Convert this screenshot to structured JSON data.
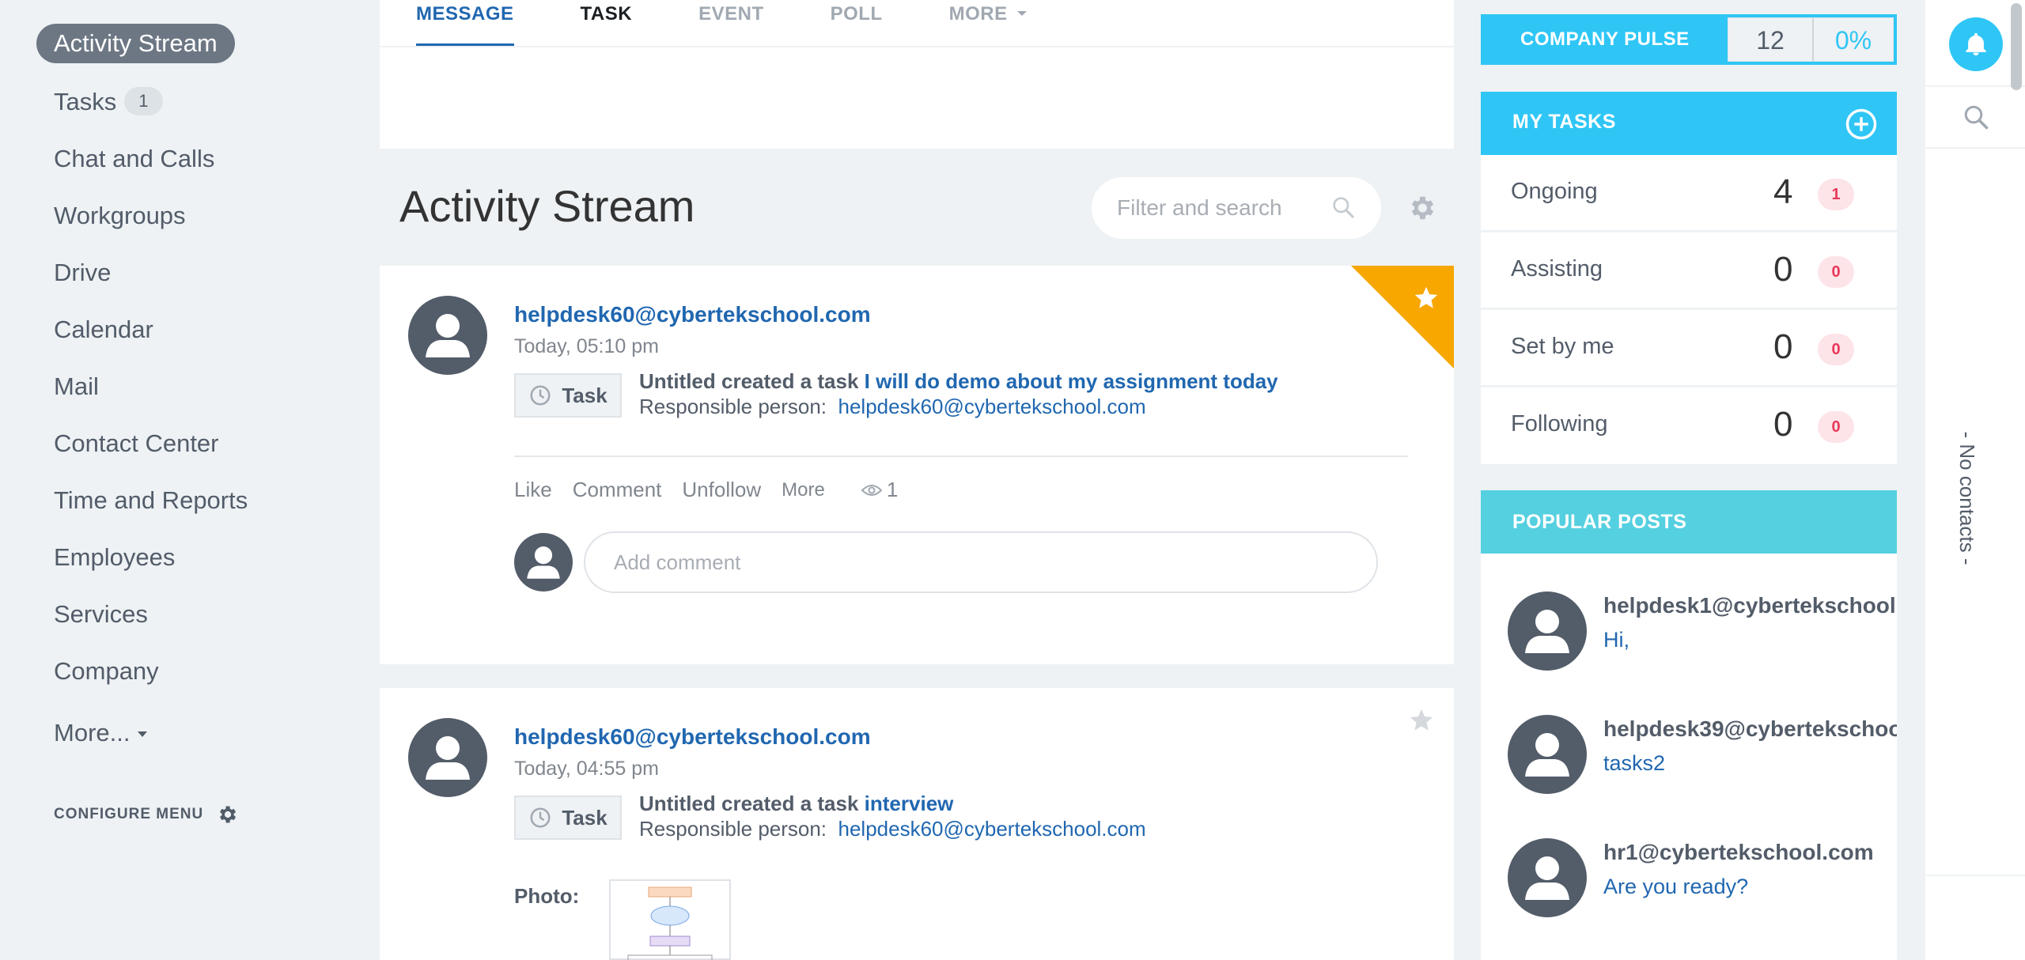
{
  "sidebar": {
    "items": [
      {
        "label": "Activity Stream"
      },
      {
        "label": "Tasks",
        "counter": "1"
      },
      {
        "label": "Chat and Calls"
      },
      {
        "label": "Workgroups"
      },
      {
        "label": "Drive"
      },
      {
        "label": "Calendar"
      },
      {
        "label": "Mail"
      },
      {
        "label": "Contact Center"
      },
      {
        "label": "Time and Reports"
      },
      {
        "label": "Employees"
      },
      {
        "label": "Services"
      },
      {
        "label": "Company"
      },
      {
        "label": "More..."
      }
    ],
    "configure_label": "CONFIGURE MENU"
  },
  "composer": {
    "tabs": [
      {
        "label": "MESSAGE"
      },
      {
        "label": "TASK"
      },
      {
        "label": "EVENT"
      },
      {
        "label": "POLL"
      },
      {
        "label": "MORE"
      }
    ]
  },
  "stream": {
    "title": "Activity Stream",
    "search_placeholder": "Filter and search"
  },
  "posts": [
    {
      "author": "helpdesk60@cybertekschool.com",
      "time": "Today, 05:10 pm",
      "chip": "Task",
      "creator_text": "Untitled created a task",
      "task_title": "I will do demo about my assignment today",
      "responsible_label": "Responsible person:",
      "responsible": "helpdesk60@cybertekschool.com",
      "actions": {
        "like": "Like",
        "comment": "Comment",
        "unfollow": "Unfollow",
        "more": "More",
        "views": "1"
      },
      "comment_placeholder": "Add comment",
      "starred": true
    },
    {
      "author": "helpdesk60@cybertekschool.com",
      "time": "Today, 04:55 pm",
      "chip": "Task",
      "creator_text": "Untitled created a task",
      "task_title": "interview",
      "responsible_label": "Responsible person:",
      "responsible": "helpdesk60@cybertekschool.com",
      "photo_label": "Photo:",
      "starred": false
    }
  ],
  "pulse": {
    "label": "COMPANY PULSE",
    "count": "12",
    "percent": "0%"
  },
  "my_tasks": {
    "title": "MY TASKS",
    "rows": [
      {
        "label": "Ongoing",
        "count": "4",
        "badge": "1"
      },
      {
        "label": "Assisting",
        "count": "0",
        "badge": "0"
      },
      {
        "label": "Set by me",
        "count": "0",
        "badge": "0"
      },
      {
        "label": "Following",
        "count": "0",
        "badge": "0"
      }
    ]
  },
  "popular": {
    "title": "POPULAR POSTS",
    "items": [
      {
        "name": "helpdesk1@cybertekschool.",
        "text": "Hi,"
      },
      {
        "name": "helpdesk39@cybertekschoo",
        "text": "tasks2"
      },
      {
        "name": "hr1@cybertekschool.com",
        "text": "Are you ready?"
      }
    ]
  },
  "contacts": {
    "empty_text": "- No contacts -"
  },
  "colors": {
    "accent": "#2fc6f6",
    "link": "#2067b0",
    "star": "#f7a700",
    "badge": "#e8385a"
  }
}
